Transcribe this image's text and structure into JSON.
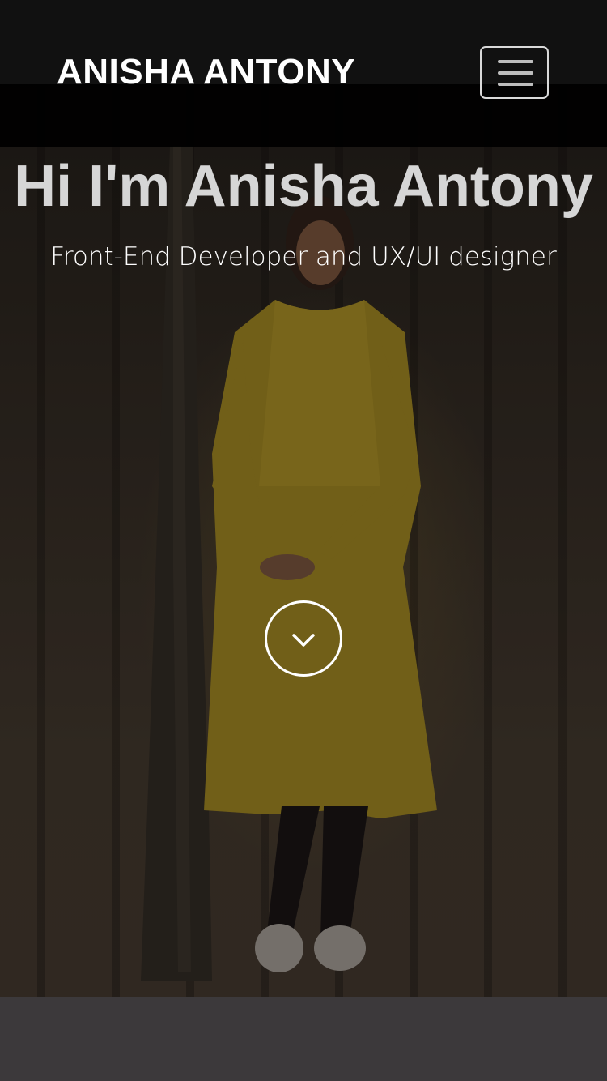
{
  "header": {
    "brand": "ANISHA ANTONY",
    "menu_icon": "hamburger-menu-icon"
  },
  "hero": {
    "greeting": "Hi I'm",
    "name": "Anisha Antony",
    "subtitle": "Front-End Developer and UX/UI designer",
    "scroll_icon": "chevron-down-icon"
  },
  "colors": {
    "header_bg": "#111111",
    "footer_band": "#3c393b",
    "headline_text": "#d6d6d6",
    "accent_yellow": "#b89a2a"
  }
}
